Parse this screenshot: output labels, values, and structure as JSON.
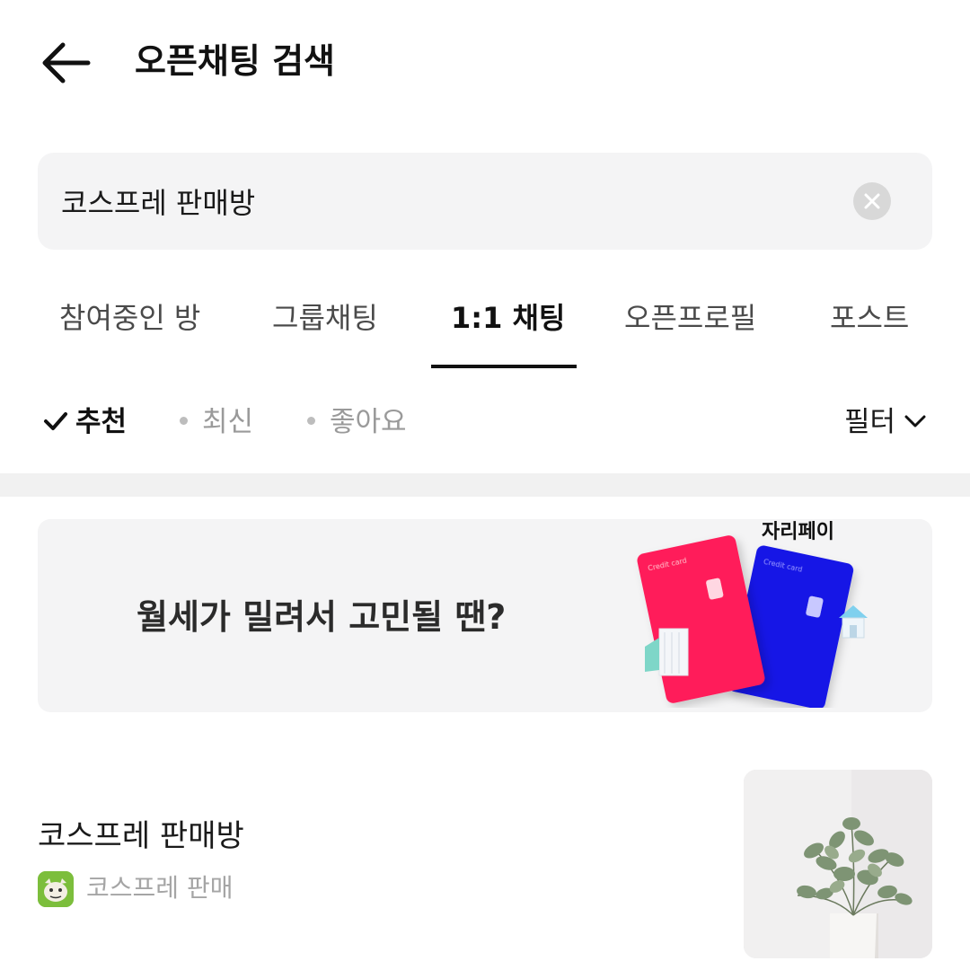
{
  "header": {
    "title": "오픈채팅 검색",
    "back_icon": "arrow-left-icon"
  },
  "search": {
    "value": "코스프레 판매방",
    "clear_icon": "clear-circle-icon"
  },
  "tabs": [
    {
      "label": "참여중인 방",
      "active": false
    },
    {
      "label": "그룹채팅",
      "active": false
    },
    {
      "label": "1:1 채팅",
      "active": true
    },
    {
      "label": "오픈프로필",
      "active": false
    },
    {
      "label": "포스트",
      "active": false
    }
  ],
  "sort": {
    "options": [
      {
        "label": "추천",
        "active": true
      },
      {
        "label": "최신",
        "active": false
      },
      {
        "label": "좋아요",
        "active": false
      }
    ],
    "filter_label": "필터"
  },
  "banner": {
    "text": "월세가 밀려서 고민될 땐?",
    "brand": "자리페이",
    "card_label_1": "Credit card",
    "card_label_2": "Credit card",
    "colors": {
      "card_red": "#ff1f5a",
      "card_blue": "#1414e6"
    }
  },
  "results": [
    {
      "title": "코스프레 판매방",
      "subtitle": "코스프레 판매",
      "avatar_icon": "profile-character-icon",
      "thumbnail": "plant-in-vase-image"
    }
  ]
}
